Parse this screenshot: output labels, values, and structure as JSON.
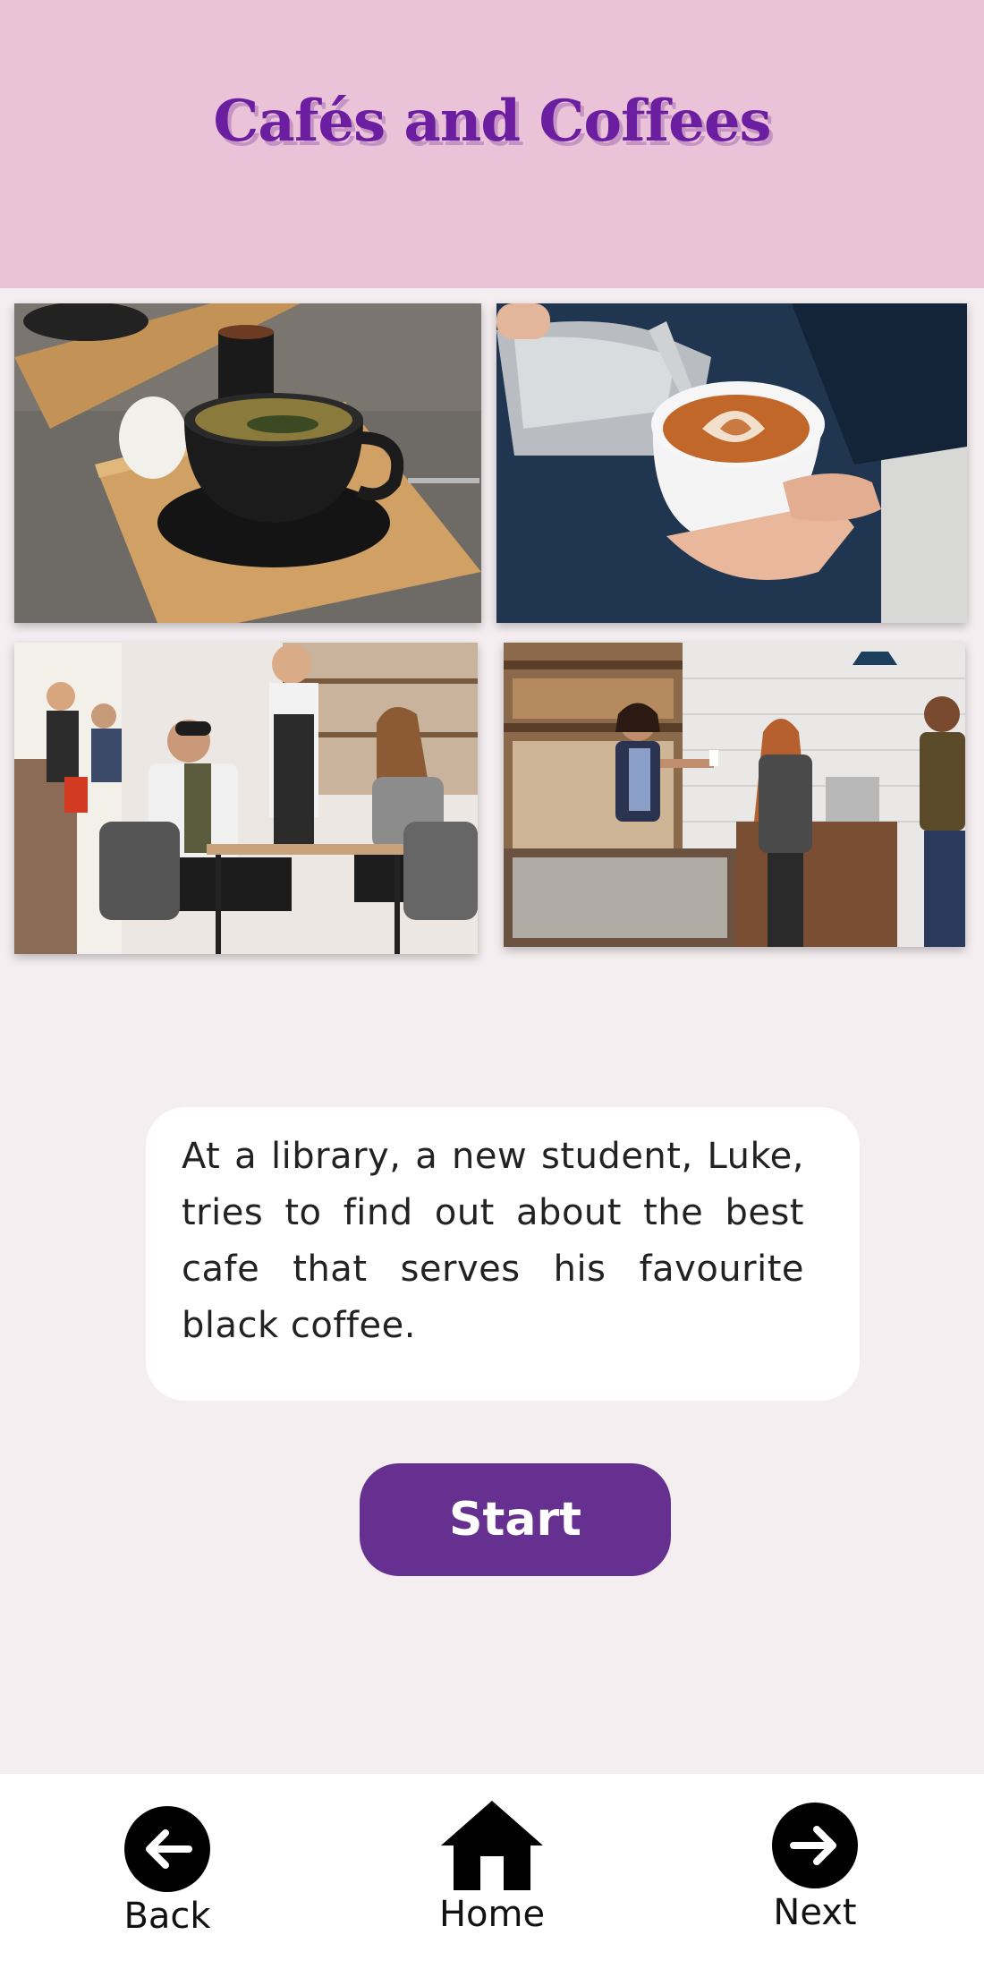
{
  "header": {
    "title": "Cafés and Coffees"
  },
  "gallery": {
    "images": [
      {
        "icon": "coffee-cup-photo"
      },
      {
        "icon": "latte-art-photo"
      },
      {
        "icon": "cafe-waiter-photo"
      },
      {
        "icon": "cafe-counter-photo"
      }
    ]
  },
  "description": {
    "text": "At a library, a new student, Luke, tries to find out about the best cafe that serves his favourite black coffee."
  },
  "actions": {
    "start_label": "Start"
  },
  "nav": {
    "back_label": "Back",
    "home_label": "Home",
    "next_label": "Next"
  },
  "colors": {
    "header_bg": "#eac3d8",
    "title": "#6b1fa0",
    "page_bg": "#f5eef1",
    "button": "#663090"
  }
}
